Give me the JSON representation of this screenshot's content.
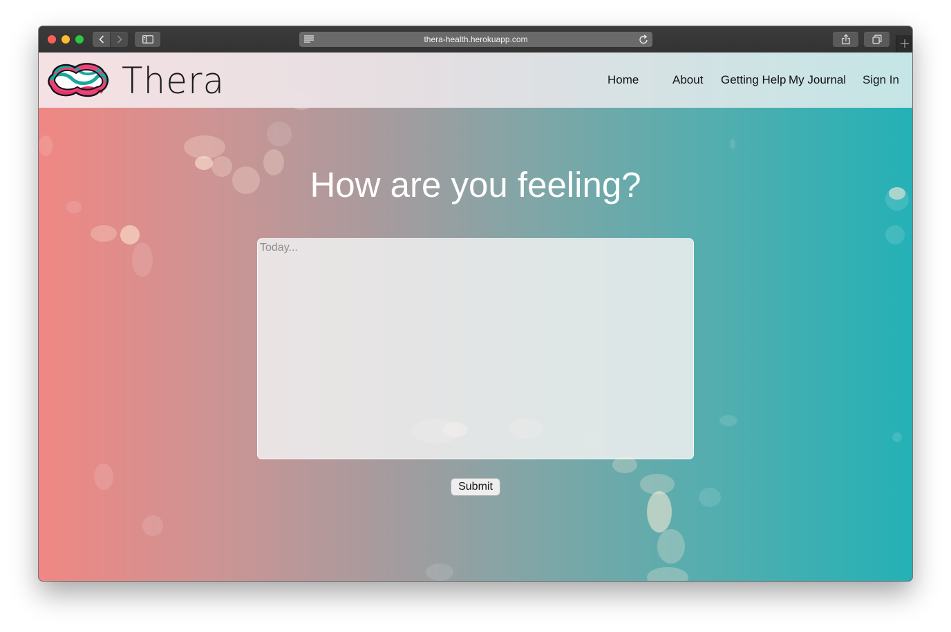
{
  "browser": {
    "url": "thera-health.herokuapp.com",
    "icons": {
      "back": "chevron-left-icon",
      "forward": "chevron-right-icon",
      "sidebar": "sidebar-icon",
      "reader": "reader-icon",
      "reload": "reload-icon",
      "share": "share-icon",
      "tabs": "tabs-overview-icon",
      "new_tab": "plus-icon"
    }
  },
  "site": {
    "logo_text": "Thera",
    "nav": {
      "home": "Home",
      "about": "About",
      "getting_help": "Getting Help",
      "my_journal": "My Journal",
      "sign_in": "Sign In"
    }
  },
  "main": {
    "heading": "How are you feeling?",
    "entry_placeholder": "Today...",
    "entry_value": "",
    "submit_label": "Submit"
  },
  "colors": {
    "gradient_left": "#f08783",
    "gradient_right": "#24b1b6",
    "logo_pink": "#e8336e",
    "logo_teal": "#1aa79e"
  }
}
